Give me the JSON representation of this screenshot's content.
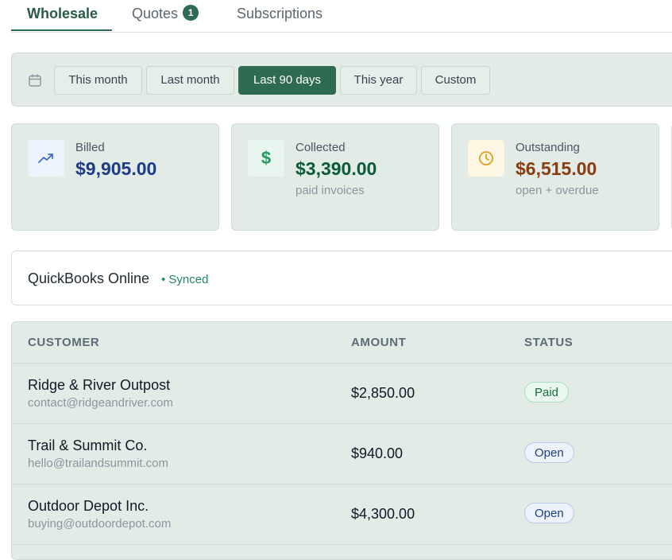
{
  "tabs": [
    {
      "label": "Wholesale"
    },
    {
      "label": "Quotes",
      "badge": "1"
    },
    {
      "label": "Subscriptions"
    }
  ],
  "filters": {
    "icon": "calendar-icon",
    "options": [
      "This month",
      "Last month",
      "Last 90 days",
      "This year",
      "Custom"
    ],
    "selected": "Last 90 days"
  },
  "stats": {
    "billed": {
      "label": "Billed",
      "value": "$9,905.00",
      "icon": "trend-up-icon",
      "color": "#1e3a8a"
    },
    "collected": {
      "label": "Collected",
      "value": "$3,390.00",
      "sub": "paid invoices",
      "icon": "dollar-icon",
      "color": "#0b5a3c"
    },
    "outstanding": {
      "label": "Outstanding",
      "value": "$6,515.00",
      "sub": "open + overdue",
      "icon": "clock-icon",
      "color": "#8a3b0f"
    }
  },
  "sync": {
    "title": "QuickBooks Online",
    "status": "• Synced"
  },
  "table": {
    "headers": {
      "customer": "CUSTOMER",
      "amount": "AMOUNT",
      "status": "STATUS"
    },
    "rows": [
      {
        "name": "Ridge & River Outpost",
        "email": "contact@ridgeandriver.com",
        "amount": "$2,850.00",
        "status": "Paid"
      },
      {
        "name": "Trail & Summit Co.",
        "email": "hello@trailandsummit.com",
        "amount": "$940.00",
        "status": "Open"
      },
      {
        "name": "Outdoor Depot Inc.",
        "email": "buying@outdoordepot.com",
        "amount": "$4,300.00",
        "status": "Open"
      }
    ]
  },
  "colors": {
    "accent": "#2e6b52",
    "panel": "#e2ebe6"
  }
}
